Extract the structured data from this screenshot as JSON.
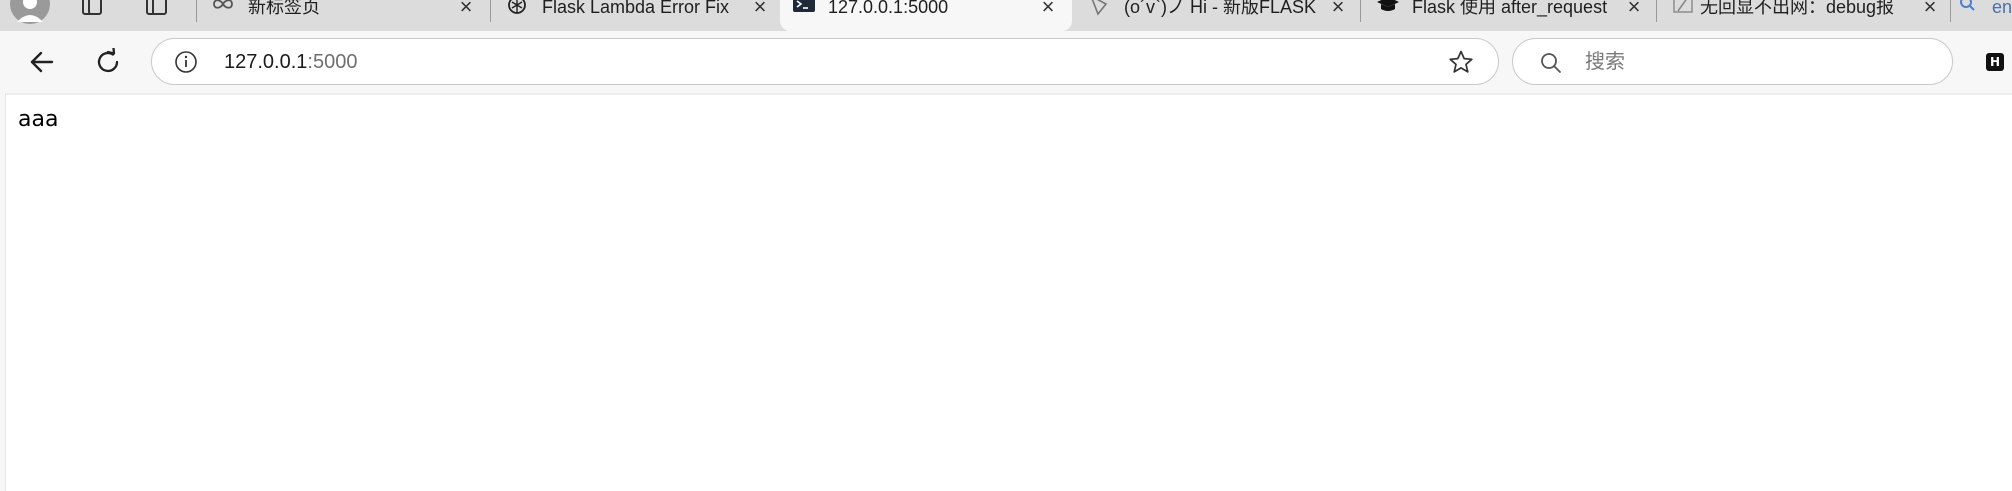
{
  "tabs": [
    {
      "title": "新标签页",
      "favicon": "infinity-icon",
      "active": false
    },
    {
      "title": "Flask Lambda Error Fix",
      "favicon": "openai-icon",
      "active": false
    },
    {
      "title": "127.0.0.1:5000",
      "favicon": "terminal-icon",
      "active": true
    },
    {
      "title": "(o´v`)ノ Hi - 新版FLASK",
      "favicon": "page-icon",
      "active": false
    },
    {
      "title": "Flask 使用 after_request",
      "favicon": "graduation-cap-icon",
      "active": false
    },
    {
      "title": "无回显不出网：debug报",
      "favicon": "slash-icon",
      "active": false
    },
    {
      "title": "en",
      "favicon": "search-icon",
      "active": false
    }
  ],
  "address_bar": {
    "host": "127.0.0.1",
    "port": ":5000"
  },
  "search_bar": {
    "placeholder": "搜索"
  },
  "extension": {
    "label": "H"
  },
  "page": {
    "text": "aaa"
  },
  "colors": {
    "tabstrip_bg": "#dcdcdc",
    "toolbar_bg": "#f7f7f7",
    "active_tab_bg": "#f7f7f7"
  }
}
